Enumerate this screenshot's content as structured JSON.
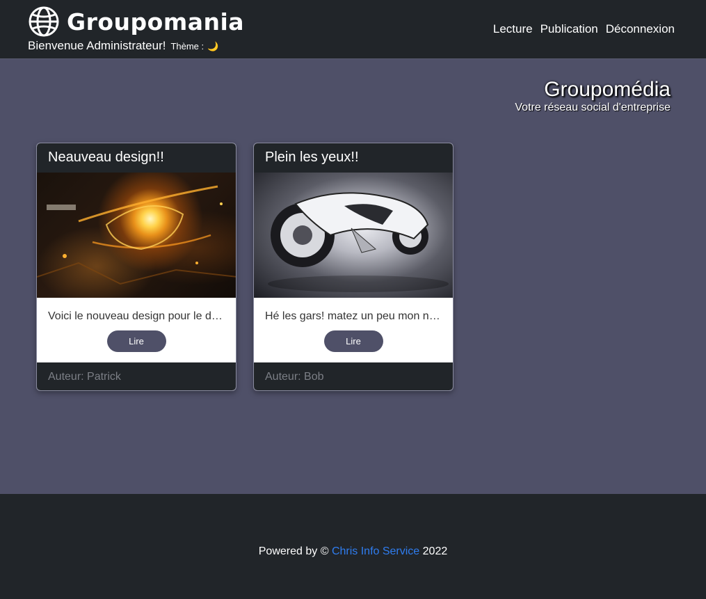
{
  "header": {
    "brand": "Groupomania",
    "welcome": "Bienvenue Administrateur!",
    "theme_label": "Thème :",
    "theme_icon": "🌙",
    "nav": [
      "Lecture",
      "Publication",
      "Déconnexion"
    ]
  },
  "hero": {
    "title": "Groupomédia",
    "subtitle": "Votre réseau social d'entreprise"
  },
  "posts": [
    {
      "title": "Neauveau design!!",
      "excerpt": "Voici le nouveau design pour le dernier modèle",
      "button": "Lire",
      "author": "Auteur: Patrick",
      "image_icon": "gpu-image"
    },
    {
      "title": "Plein les yeux!!",
      "excerpt": "Hé les gars! matez un peu mon nouveau bolide",
      "button": "Lire",
      "author": "Auteur: Bob",
      "image_icon": "motorcycle-image"
    }
  ],
  "footer": {
    "prefix": "Powered by ©",
    "link": "Chris Info Service",
    "year": "2022"
  },
  "colors": {
    "navbar": "#212529",
    "body": "#4f5068",
    "link": "#2f7df0",
    "button": "#4f5068"
  }
}
